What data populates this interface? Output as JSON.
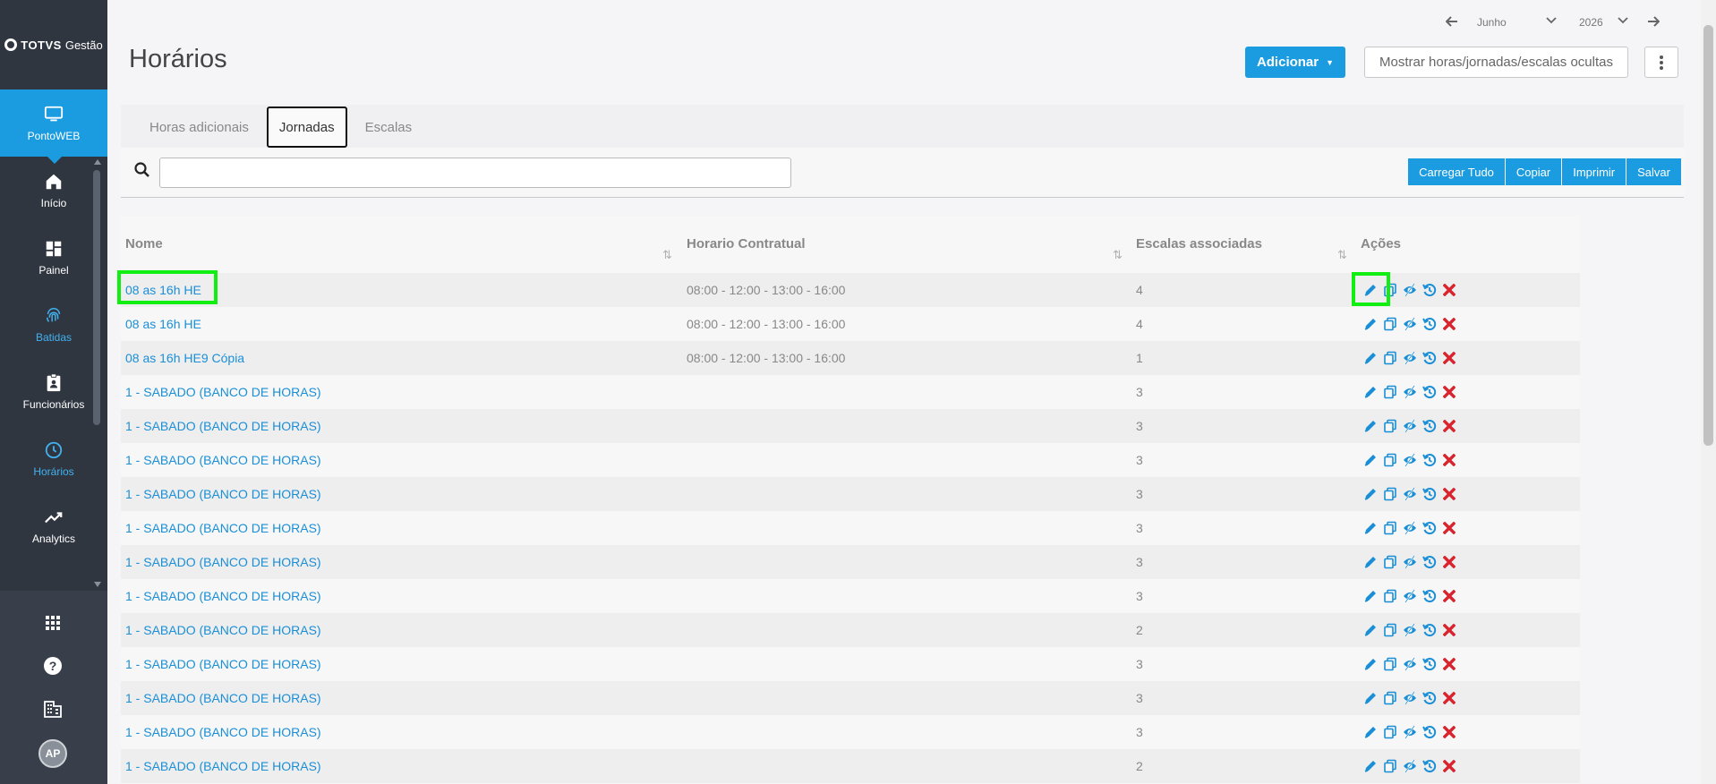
{
  "brand": {
    "bold": "TOTVS",
    "light": "Gestão"
  },
  "sidebar": {
    "items": [
      {
        "label": "PontoWEB",
        "icon": "monitor-icon"
      },
      {
        "label": "Início",
        "icon": "home-icon"
      },
      {
        "label": "Painel",
        "icon": "dashboard-icon"
      },
      {
        "label": "Batidas",
        "icon": "fingerprint-icon"
      },
      {
        "label": "Funcionários",
        "icon": "badge-icon"
      },
      {
        "label": "Horários",
        "icon": "clock-icon"
      },
      {
        "label": "Analytics",
        "icon": "trend-icon"
      }
    ],
    "bottom": {
      "avatar_initials": "AP",
      "icons": [
        "apps-grid-icon",
        "help-icon",
        "building-icon"
      ]
    }
  },
  "header": {
    "title": "Horários",
    "month": "Junho",
    "year": "2026",
    "add_button": "Adicionar",
    "show_hidden_button": "Mostrar horas/jornadas/escalas ocultas"
  },
  "tabs": [
    "Horas adicionais",
    "Jornadas",
    "Escalas"
  ],
  "active_tab": "Jornadas",
  "search": {
    "placeholder": "",
    "value": ""
  },
  "toolbar": {
    "load_all": "Carregar Tudo",
    "copy": "Copiar",
    "print": "Imprimir",
    "save": "Salvar"
  },
  "table": {
    "headers": [
      "Nome",
      "Horario Contratual",
      "Escalas associadas",
      "Ações"
    ],
    "rows": [
      {
        "name": "08 as 16h HE",
        "schedule": "08:00 - 12:00 - 13:00 - 16:00",
        "scales": "4"
      },
      {
        "name": "08 as 16h HE",
        "schedule": "08:00 - 12:00 - 13:00 - 16:00",
        "scales": "4"
      },
      {
        "name": "08 as 16h HE9 Cópia",
        "schedule": "08:00 - 12:00 - 13:00 - 16:00",
        "scales": "1"
      },
      {
        "name": "1 - SABADO (BANCO DE HORAS)",
        "schedule": "",
        "scales": "3"
      },
      {
        "name": "1 - SABADO (BANCO DE HORAS)",
        "schedule": "",
        "scales": "3"
      },
      {
        "name": "1 - SABADO (BANCO DE HORAS)",
        "schedule": "",
        "scales": "3"
      },
      {
        "name": "1 - SABADO (BANCO DE HORAS)",
        "schedule": "",
        "scales": "3"
      },
      {
        "name": "1 - SABADO (BANCO DE HORAS)",
        "schedule": "",
        "scales": "3"
      },
      {
        "name": "1 - SABADO (BANCO DE HORAS)",
        "schedule": "",
        "scales": "3"
      },
      {
        "name": "1 - SABADO (BANCO DE HORAS)",
        "schedule": "",
        "scales": "3"
      },
      {
        "name": "1 - SABADO (BANCO DE HORAS)",
        "schedule": "",
        "scales": "2"
      },
      {
        "name": "1 - SABADO (BANCO DE HORAS)",
        "schedule": "",
        "scales": "3"
      },
      {
        "name": "1 - SABADO (BANCO DE HORAS)",
        "schedule": "",
        "scales": "3"
      },
      {
        "name": "1 - SABADO (BANCO DE HORAS)",
        "schedule": "",
        "scales": "3"
      },
      {
        "name": "1 - SABADO (BANCO DE HORAS)",
        "schedule": "",
        "scales": "2"
      }
    ],
    "action_icons": [
      "edit-icon",
      "copy-icon",
      "hide-icon",
      "history-icon",
      "delete-icon"
    ]
  },
  "colors": {
    "accent": "#1b9ce0",
    "sidebar": "#2f3640",
    "link": "#1b8fd6",
    "delete": "#d9232d",
    "highlight": "#11ee11"
  }
}
